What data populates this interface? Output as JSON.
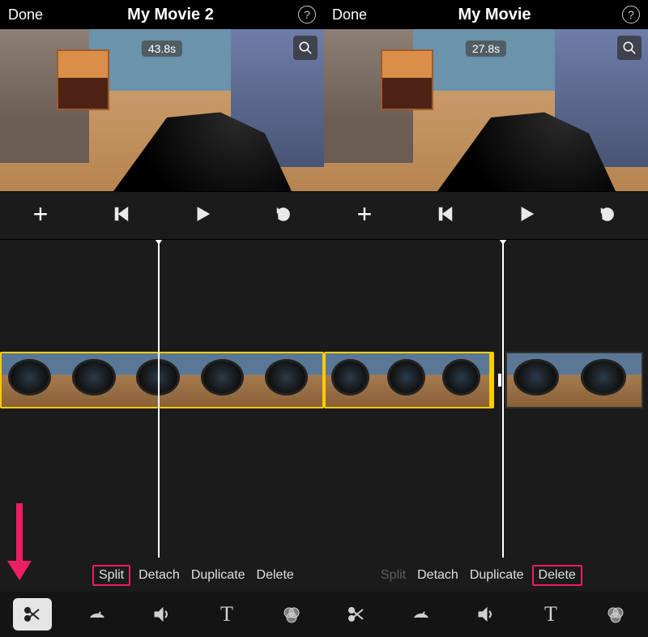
{
  "left": {
    "header": {
      "done": "Done",
      "title": "My Movie 2"
    },
    "preview": {
      "time": "43.8s"
    },
    "actions": {
      "split": "Split",
      "detach": "Detach",
      "duplicate": "Duplicate",
      "del": "Delete"
    },
    "highlight": "split",
    "scissors_active": true
  },
  "right": {
    "header": {
      "done": "Done",
      "title": "My Movie"
    },
    "preview": {
      "time": "27.8s"
    },
    "actions": {
      "split": "Split",
      "detach": "Detach",
      "duplicate": "Duplicate",
      "del": "Delete"
    },
    "split_disabled": true,
    "highlight": "delete",
    "scissors_active": false
  },
  "icons": {
    "help": "?",
    "add": "+",
    "text_tool": "T"
  }
}
